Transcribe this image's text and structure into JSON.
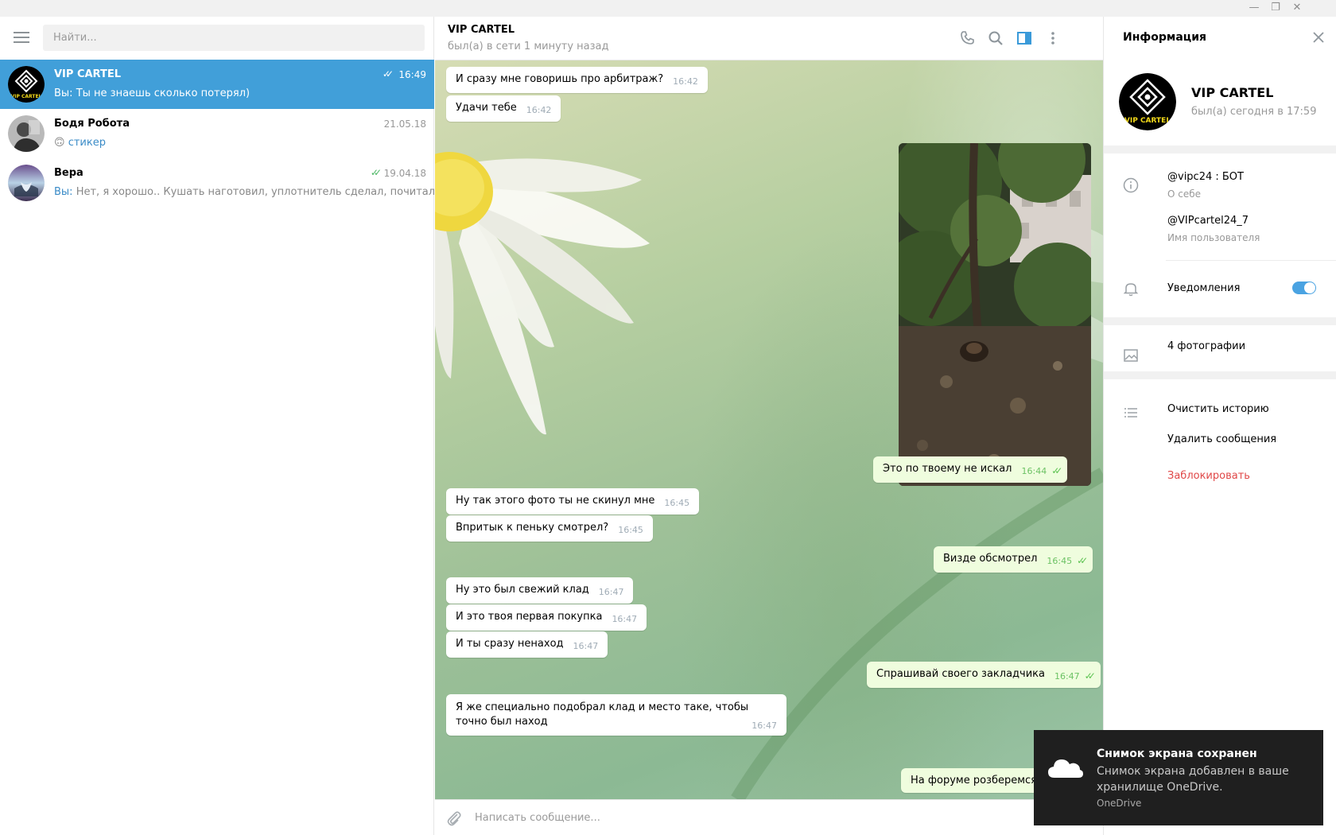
{
  "colors": {
    "accent": "#419fd9",
    "outgoing_bubble": "#effdde",
    "read_ticks": "#5dc452",
    "danger": "#e04848",
    "toggle_on": "#4aa3e2"
  },
  "window_controls": {
    "minimize": "—",
    "restore": "❐",
    "close": "✕"
  },
  "sidebar": {
    "search_placeholder": "Найти...",
    "dialogs": [
      {
        "name": "VIP CARTEL",
        "time": "16:49",
        "ticks": "✓✓",
        "prefix": "Вы: ",
        "message": "Ты не знаешь сколько потерял)",
        "active": true
      },
      {
        "name": "Бодя Робота",
        "time": "21.05.18",
        "emoji": "🙃",
        "message": "стикер"
      },
      {
        "name": "Вера",
        "time": "19.04.18",
        "ticks": "✓✓",
        "prefix": "Вы: ",
        "message": "Нет, я хорошо.. Кушать наготовил, уплотнитель сделал, почитал"
      }
    ]
  },
  "chat": {
    "title": "VIP CARTEL",
    "status": "был(а) в сети 1 минуту назад",
    "composer_placeholder": "Написать сообщение...",
    "messages": [
      {
        "dir": "in",
        "text": "И сразу мне говоришь про арбитраж?",
        "time": "16:42"
      },
      {
        "dir": "in",
        "text": "Удачи тебе",
        "time": "16:42"
      },
      {
        "dir": "out",
        "text": "Это по твоему не искал",
        "time": "16:44",
        "ticks": "✓✓"
      },
      {
        "dir": "in",
        "text": "Ну так этого фото ты не скинул мне",
        "time": "16:45"
      },
      {
        "dir": "in",
        "text": "Впритык к пеньку смотрел?",
        "time": "16:45"
      },
      {
        "dir": "out",
        "text": "Визде обсмотрел",
        "time": "16:45",
        "ticks": "✓✓"
      },
      {
        "dir": "in",
        "text": "Ну это был свежий клад",
        "time": "16:47"
      },
      {
        "dir": "in",
        "text": "И это твоя первая покупка",
        "time": "16:47"
      },
      {
        "dir": "in",
        "text": "И ты сразу ненаход",
        "time": "16:47"
      },
      {
        "dir": "out",
        "text": "Спрашивай своего закладчика",
        "time": "16:47",
        "ticks": "✓✓"
      },
      {
        "dir": "in",
        "text": "Я же специально подобрал клад и место таке, чтобы точно был наход",
        "time": "16:47"
      },
      {
        "dir": "out",
        "text": "На форуме розберемся",
        "time": ""
      }
    ]
  },
  "info": {
    "title": "Информация",
    "name": "VIP CARTEL",
    "status": "был(а) сегодня в 17:59",
    "bio": "@vipc24 : БОТ",
    "bio_label": "О себе",
    "username": "@VIPcartel24_7",
    "username_label": "Имя пользователя",
    "notifications": "Уведомления",
    "notifications_on": true,
    "photos": "4 фотографии",
    "clear_history": "Очистить историю",
    "delete_messages": "Удалить сообщения",
    "block": "Заблокировать"
  },
  "avatar_logo_text": "VIP CARTEL",
  "toast": {
    "title": "Снимок экрана сохранен",
    "body": "Снимок экрана добавлен в ваше хранилище OneDrive.",
    "source": "OneDrive"
  }
}
